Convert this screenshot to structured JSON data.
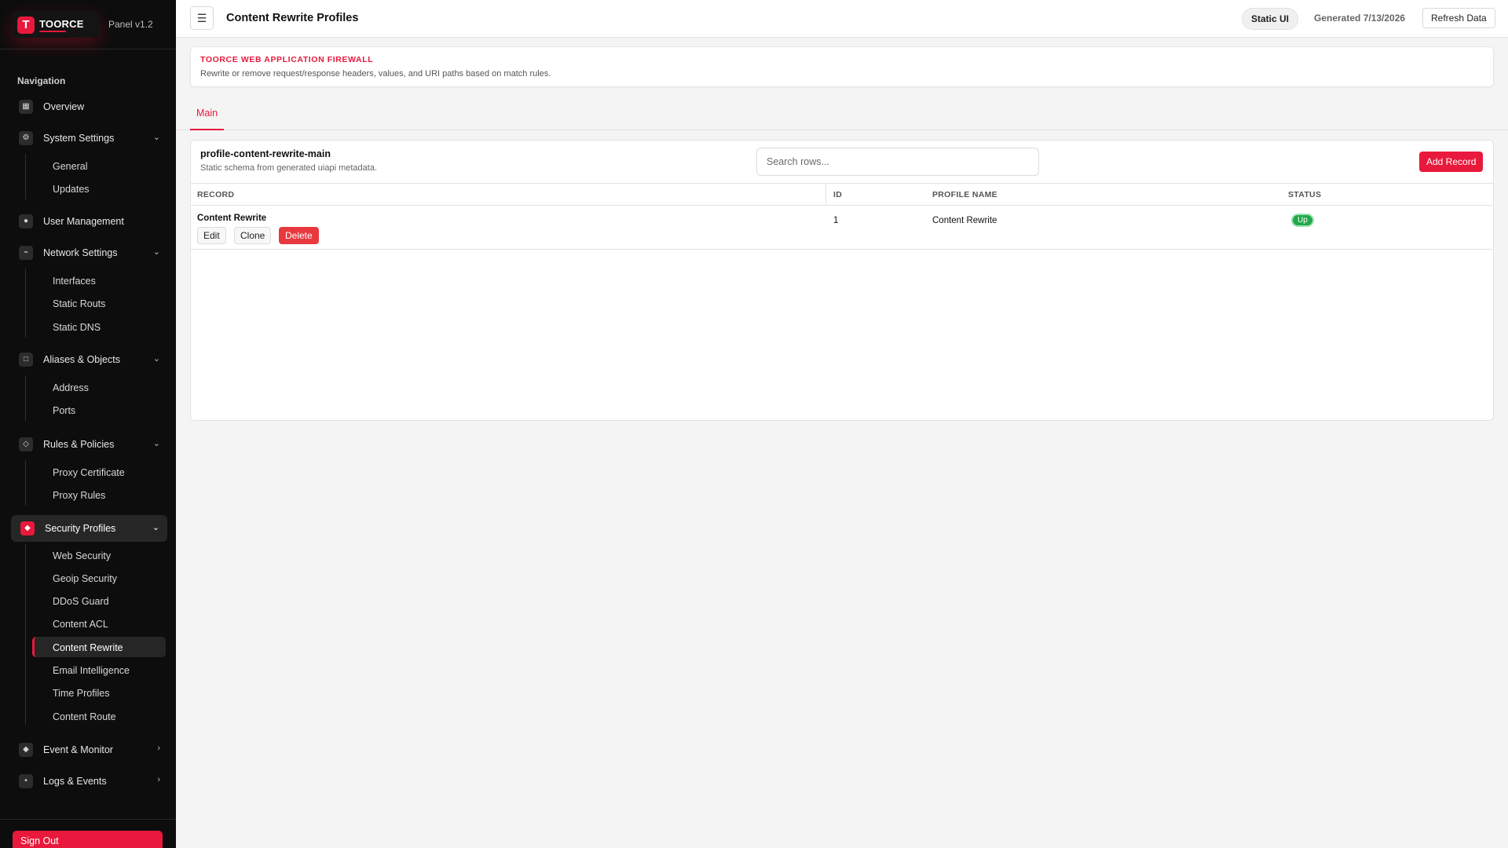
{
  "brand": {
    "logo_letter": "T",
    "name": "TOORCE",
    "panel_version": "Panel v1.2",
    "accent_color": "#e8193c"
  },
  "sidebar": {
    "heading": "Navigation",
    "overview": {
      "label": "Overview",
      "icon": "grid-icon"
    },
    "system_settings": {
      "label": "System Settings",
      "icon": "gear-icon",
      "items": [
        "General",
        "Updates"
      ]
    },
    "user_management": {
      "label": "User Management",
      "icon": "user-icon"
    },
    "network_settings": {
      "label": "Network Settings",
      "icon": "network-icon",
      "items": [
        "Interfaces",
        "Static Routs",
        "Static DNS"
      ]
    },
    "aliases_objects": {
      "label": "Aliases & Objects",
      "icon": "box-icon",
      "items": [
        "Address",
        "Ports"
      ]
    },
    "rules_policies": {
      "label": "Rules & Policies",
      "icon": "diamond-icon",
      "items": [
        "Proxy Certificate",
        "Proxy Rules"
      ]
    },
    "security_profiles": {
      "label": "Security Profiles",
      "icon": "shield-icon",
      "items": [
        "Web Security",
        "Geoip Security",
        "DDoS Guard",
        "Content ACL",
        "Content Rewrite",
        "Email Intelligence",
        "Time Profiles",
        "Content Route"
      ],
      "active_item": "Content Rewrite"
    },
    "event_monitor": {
      "label": "Event & Monitor",
      "icon": "monitor-icon"
    },
    "logs_events": {
      "label": "Logs & Events",
      "icon": "log-icon"
    },
    "sign_out": "Sign Out"
  },
  "header": {
    "title": "Content Rewrite Profiles",
    "static_badge": "Static UI",
    "generated": "Generated 7/13/2026",
    "refresh_label": "Refresh Data"
  },
  "banner": {
    "title": "TOORCE WEB APPLICATION FIREWALL",
    "description": "Rewrite or remove request/response headers, values, and URI paths based on match rules."
  },
  "tabs": [
    {
      "label": "Main",
      "active": true
    }
  ],
  "table_card": {
    "name": "profile-content-rewrite-main",
    "subtitle": "Static schema from generated uiapi metadata.",
    "search_placeholder": "Search rows...",
    "add_label": "Add Record",
    "columns": [
      "RECORD",
      "ID",
      "PROFILE NAME",
      "STATUS"
    ],
    "rows": [
      {
        "record": "Content Rewrite",
        "id": "1",
        "profile_name": "Content Rewrite",
        "status": "Up",
        "actions": [
          "Edit",
          "Clone",
          "Delete"
        ]
      }
    ]
  }
}
